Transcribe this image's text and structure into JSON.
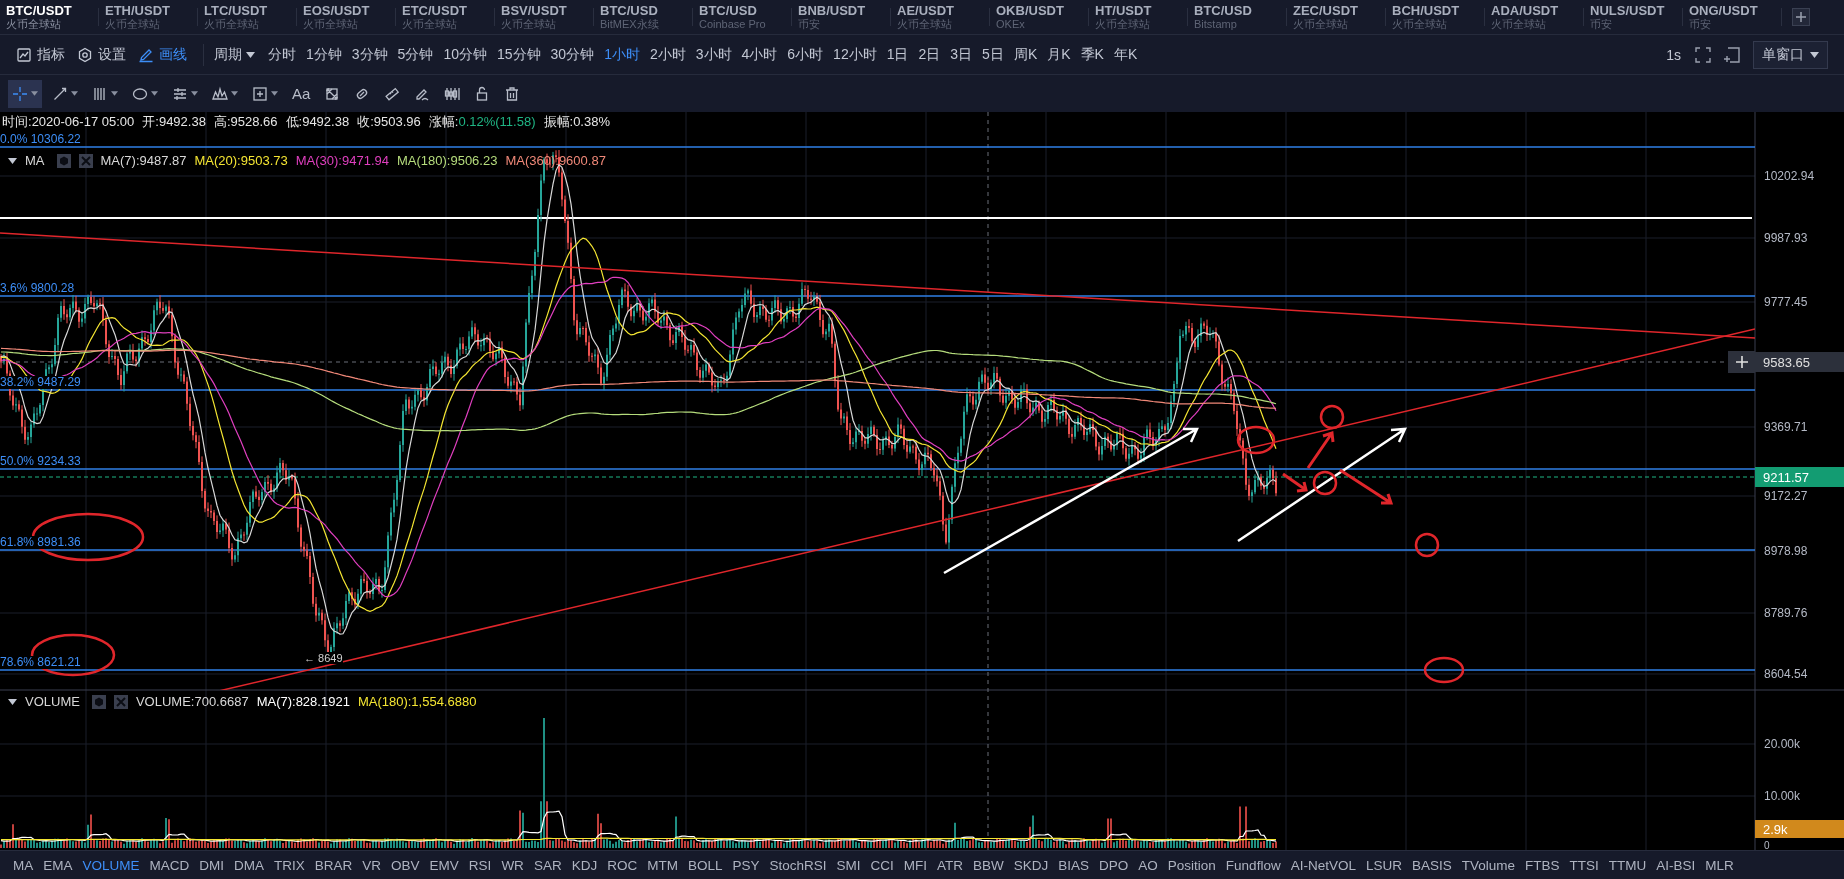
{
  "markets": [
    {
      "pair": "BTC/USDT",
      "exchange": "火币全球站",
      "selected": true
    },
    {
      "pair": "ETH/USDT",
      "exchange": "火币全球站",
      "selected": false
    },
    {
      "pair": "LTC/USDT",
      "exchange": "火币全球站",
      "selected": false
    },
    {
      "pair": "EOS/USDT",
      "exchange": "火币全球站",
      "selected": false
    },
    {
      "pair": "ETC/USDT",
      "exchange": "火币全球站",
      "selected": false
    },
    {
      "pair": "BSV/USDT",
      "exchange": "火币全球站",
      "selected": false
    },
    {
      "pair": "BTC/USD",
      "exchange": "BitMEX永续",
      "selected": false
    },
    {
      "pair": "BTC/USD",
      "exchange": "Coinbase Pro",
      "selected": false
    },
    {
      "pair": "BNB/USDT",
      "exchange": "币安",
      "selected": false
    },
    {
      "pair": "AE/USDT",
      "exchange": "火币全球站",
      "selected": false
    },
    {
      "pair": "OKB/USDT",
      "exchange": "OKEx",
      "selected": false
    },
    {
      "pair": "HT/USDT",
      "exchange": "火币全球站",
      "selected": false
    },
    {
      "pair": "BTC/USD",
      "exchange": "Bitstamp",
      "selected": false
    },
    {
      "pair": "ZEC/USDT",
      "exchange": "火币全球站",
      "selected": false
    },
    {
      "pair": "BCH/USDT",
      "exchange": "火币全球站",
      "selected": false
    },
    {
      "pair": "ADA/USDT",
      "exchange": "火币全球站",
      "selected": false
    },
    {
      "pair": "NULS/USDT",
      "exchange": "币安",
      "selected": false
    },
    {
      "pair": "ONG/USDT",
      "exchange": "币安",
      "selected": false
    }
  ],
  "toolbar": {
    "tools": [
      {
        "kind": "indicator",
        "label": "指标",
        "active": false
      },
      {
        "kind": "settings",
        "label": "设置",
        "active": false
      },
      {
        "kind": "draw",
        "label": "画线",
        "active": true
      }
    ],
    "period_menu": "周期",
    "periods": [
      {
        "label": "分时",
        "selected": false
      },
      {
        "label": "1分钟",
        "selected": false
      },
      {
        "label": "3分钟",
        "selected": false
      },
      {
        "label": "5分钟",
        "selected": false
      },
      {
        "label": "10分钟",
        "selected": false
      },
      {
        "label": "15分钟",
        "selected": false
      },
      {
        "label": "30分钟",
        "selected": false
      },
      {
        "label": "1小时",
        "selected": true
      },
      {
        "label": "2小时",
        "selected": false
      },
      {
        "label": "3小时",
        "selected": false
      },
      {
        "label": "4小时",
        "selected": false
      },
      {
        "label": "6小时",
        "selected": false
      },
      {
        "label": "12小时",
        "selected": false
      },
      {
        "label": "1日",
        "selected": false
      },
      {
        "label": "2日",
        "selected": false
      },
      {
        "label": "3日",
        "selected": false
      },
      {
        "label": "5日",
        "selected": false
      },
      {
        "label": "周K",
        "selected": false
      },
      {
        "label": "月K",
        "selected": false
      },
      {
        "label": "季K",
        "selected": false
      },
      {
        "label": "年K",
        "selected": false
      }
    ],
    "refresh_interval": "1s",
    "window_mode": "单窗口"
  },
  "drawing_tools": [
    {
      "kind": "crosshair",
      "dropdown": true,
      "selected": true
    },
    {
      "kind": "line",
      "dropdown": true,
      "selected": false
    },
    {
      "kind": "channel",
      "dropdown": true,
      "selected": false
    },
    {
      "kind": "ellipse",
      "dropdown": true,
      "selected": false
    },
    {
      "kind": "fib",
      "dropdown": true,
      "selected": false
    },
    {
      "kind": "wave",
      "dropdown": true,
      "selected": false
    },
    {
      "kind": "box",
      "dropdown": true,
      "selected": false
    },
    {
      "kind": "text",
      "label": "Aa",
      "dropdown": false,
      "selected": false
    },
    {
      "kind": "pattern",
      "dropdown": false,
      "selected": false
    },
    {
      "kind": "eraser",
      "dropdown": false,
      "selected": false
    },
    {
      "kind": "ruler",
      "dropdown": false,
      "selected": false
    },
    {
      "kind": "brush",
      "dropdown": false,
      "selected": false
    },
    {
      "kind": "candles",
      "dropdown": false,
      "selected": false
    },
    {
      "kind": "lock",
      "dropdown": false,
      "selected": false
    },
    {
      "kind": "trash",
      "dropdown": false,
      "selected": false
    }
  ],
  "chart": {
    "info": [
      {
        "label": "时间:",
        "value": "2020-06-17 05:00"
      },
      {
        "label": "开:",
        "value": "9492.38"
      },
      {
        "label": "高:",
        "value": "9528.66"
      },
      {
        "label": "低:",
        "value": "9492.38"
      },
      {
        "label": "收:",
        "value": "9503.96"
      },
      {
        "label": "涨幅:",
        "value": "0.12%(11.58)",
        "color": "#1fb584"
      },
      {
        "label": "振幅:",
        "value": "0.38%"
      }
    ],
    "ma_legend": {
      "title": "MA",
      "lines": [
        {
          "label": "MA(7):9487.87",
          "color": "#d8d8d8"
        },
        {
          "label": "MA(20):9503.73",
          "color": "#f4e532"
        },
        {
          "label": "MA(30):9471.94",
          "color": "#e03fbf"
        },
        {
          "label": "MA(180):9506.23",
          "color": "#b5dc7c"
        },
        {
          "label": "MA(360):9600.87",
          "color": "#f08878"
        }
      ]
    },
    "fib_labels": [
      "0.0% 10306.22",
      "3.6% 9800.28",
      "38.2% 9487.29",
      "50.0% 9234.33",
      "61.8% 8981.36",
      "78.6% 8621.21"
    ],
    "low_label": "← 8649",
    "price_ticks": [
      "10202.94",
      "9987.93",
      "9777.45",
      "9369.71",
      "9172.27",
      "8978.98",
      "8789.76",
      "8604.54"
    ],
    "crosshair_price": "9583.65",
    "last_price": "9211.57",
    "volume_legend": {
      "title": "VOLUME",
      "lines": [
        {
          "label": "VOLUME:700.6687",
          "color": "#d8d8d8"
        },
        {
          "label": "MA(7):828.1921",
          "color": "#ffffff"
        },
        {
          "label": "MA(180):1,554.6880",
          "color": "#f4e532"
        }
      ]
    },
    "volume_ticks": [
      "20.00k",
      "10.00k",
      "0"
    ],
    "volume_last": "2.9k"
  },
  "indicators": [
    {
      "label": "MA",
      "selected": false
    },
    {
      "label": "EMA",
      "selected": false
    },
    {
      "label": "VOLUME",
      "selected": true
    },
    {
      "label": "MACD",
      "selected": false
    },
    {
      "label": "DMI",
      "selected": false
    },
    {
      "label": "DMA",
      "selected": false
    },
    {
      "label": "TRIX",
      "selected": false
    },
    {
      "label": "BRAR",
      "selected": false
    },
    {
      "label": "VR",
      "selected": false
    },
    {
      "label": "OBV",
      "selected": false
    },
    {
      "label": "EMV",
      "selected": false
    },
    {
      "label": "RSI",
      "selected": false
    },
    {
      "label": "WR",
      "selected": false
    },
    {
      "label": "SAR",
      "selected": false
    },
    {
      "label": "KDJ",
      "selected": false
    },
    {
      "label": "ROC",
      "selected": false
    },
    {
      "label": "MTM",
      "selected": false
    },
    {
      "label": "BOLL",
      "selected": false
    },
    {
      "label": "PSY",
      "selected": false
    },
    {
      "label": "StochRSI",
      "selected": false
    },
    {
      "label": "SMI",
      "selected": false
    },
    {
      "label": "CCI",
      "selected": false
    },
    {
      "label": "MFI",
      "selected": false
    },
    {
      "label": "ATR",
      "selected": false
    },
    {
      "label": "BBW",
      "selected": false
    },
    {
      "label": "SKDJ",
      "selected": false
    },
    {
      "label": "BIAS",
      "selected": false
    },
    {
      "label": "DPO",
      "selected": false
    },
    {
      "label": "AO",
      "selected": false
    },
    {
      "label": "Position",
      "selected": false
    },
    {
      "label": "Fundflow",
      "selected": false
    },
    {
      "label": "AI-NetVOL",
      "selected": false
    },
    {
      "label": "LSUR",
      "selected": false
    },
    {
      "label": "BASIS",
      "selected": false
    },
    {
      "label": "TVolume",
      "selected": false
    },
    {
      "label": "FTBS",
      "selected": false
    },
    {
      "label": "TTSI",
      "selected": false
    },
    {
      "label": "TTMU",
      "selected": false
    },
    {
      "label": "AI-BSI",
      "selected": false
    },
    {
      "label": "MLR",
      "selected": false
    }
  ]
}
